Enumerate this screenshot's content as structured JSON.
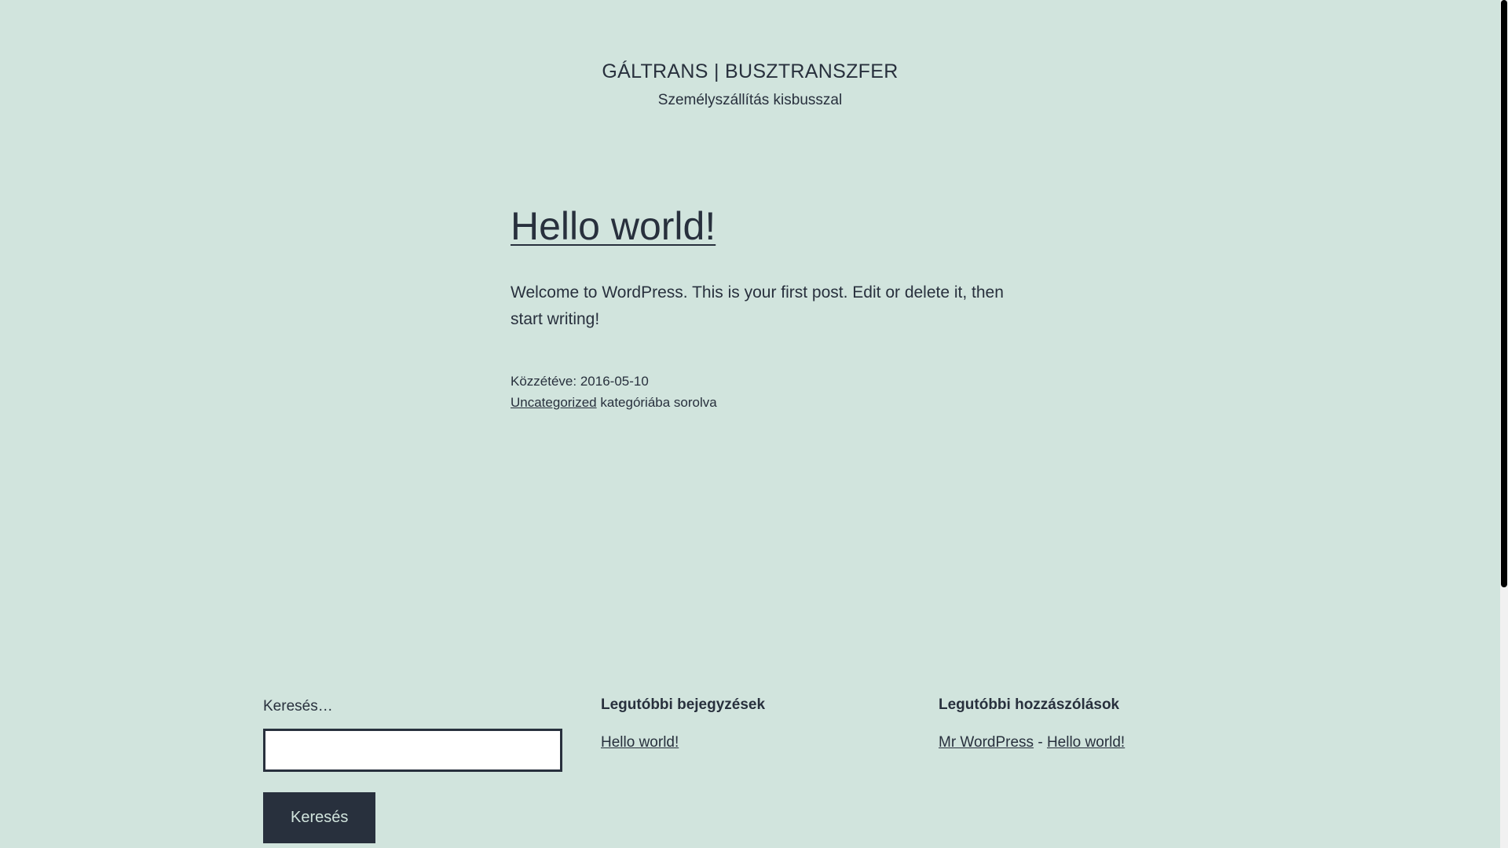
{
  "header": {
    "site_title": "GÁLTRANS | BUSZTRANSZFER",
    "tagline": "Személyszállítás kisbusszal"
  },
  "post": {
    "title": "Hello world!",
    "content": "Welcome to WordPress. This is your first post. Edit or delete it, then start writing!",
    "published_label": "Közzétéve:",
    "published_date": "2016-05-10",
    "category": "Uncategorized",
    "category_suffix": "kategóriába sorolva"
  },
  "footer": {
    "search": {
      "label": "Keresés…",
      "input_value": "",
      "button_label": "Keresés"
    },
    "recent_posts": {
      "title": "Legutóbbi bejegyzések",
      "items": [
        "Hello world!"
      ]
    },
    "recent_comments": {
      "title": "Legutóbbi hozzászólások",
      "author": "Mr WordPress",
      "separator": "-",
      "post": "Hello world!"
    }
  },
  "colors": {
    "background": "#d1e4dd",
    "text": "#28303d",
    "button_background": "#28303d",
    "button_text": "#d1e4dd"
  }
}
